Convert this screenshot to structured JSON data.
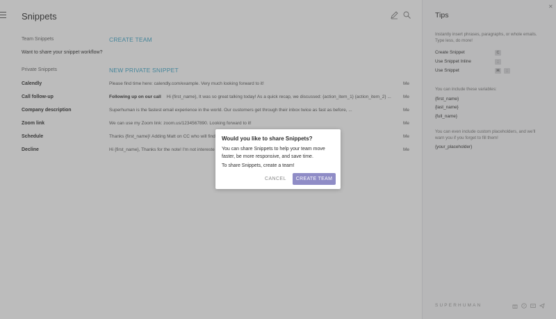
{
  "main": {
    "title": "Snippets",
    "team": {
      "label": "Team Snippets",
      "action": "CREATE TEAM",
      "prompt": "Want to share your snippet workflow?"
    },
    "private": {
      "label": "Private Snippets",
      "action": "NEW PRIVATE SNIPPET"
    },
    "snippets": [
      {
        "name": "Calendly",
        "subject": "",
        "body": "Please find time here: calendly.com/example. Very much looking forward to it!",
        "owner": "Me"
      },
      {
        "name": "Call follow-up",
        "subject": "Following up on our call",
        "body": "Hi {first_name}, It was so great talking today! As a quick recap, we discussed: {action_item_1} {action_item_2} ...",
        "owner": "Me"
      },
      {
        "name": "Company description",
        "subject": "",
        "body": "Superhuman is the fastest email experience in the world. Our customers get through their inbox twice as fast as before, ...",
        "owner": "Me"
      },
      {
        "name": "Zoom link",
        "subject": "",
        "body": "We can use my Zoom link: zoom.us/1234567890. Looking forward to it!",
        "owner": "Me"
      },
      {
        "name": "Schedule",
        "subject": "",
        "body": "Thanks {first_name}! Adding Matt on CC who will find",
        "owner": "Me"
      },
      {
        "name": "Decline",
        "subject": "",
        "body": "Hi {first_name}, Thanks for the note! I'm not intereste",
        "owner": "Me"
      }
    ]
  },
  "tips": {
    "title": "Tips",
    "close": "✕",
    "intro": "Instantly insert phrases, paragraphs, or whole emails. Type less, do more!",
    "shortcuts": [
      {
        "label": "Create Snippet",
        "keys": [
          "C"
        ]
      },
      {
        "label": "Use Snippet Inline",
        "keys": [
          ";"
        ]
      },
      {
        "label": "Use Snippet",
        "keys": [
          "⌘",
          ";"
        ]
      }
    ],
    "variables_intro": "You can include these variables:",
    "variables": [
      "{first_name}",
      "{last_name}",
      "{full_name}"
    ],
    "placeholders_intro": "You can even include custom placeholders, and we'll warn you if you forget to fill them!",
    "placeholder_example": "{your_placeholder}",
    "brand": "SUPERHUMAN"
  },
  "dialog": {
    "title": "Would you like to share Snippets?",
    "body": "You can share Snippets to help your team move faster, be more responsive, and save time.",
    "body2": "To share Snippets, create a team!",
    "cancel": "CANCEL",
    "confirm": "CREATE TEAM"
  },
  "colors": {
    "accent": "#3ea6c8",
    "button": "#8f8cc6",
    "overlay": "rgba(80,80,80,0.38)"
  }
}
